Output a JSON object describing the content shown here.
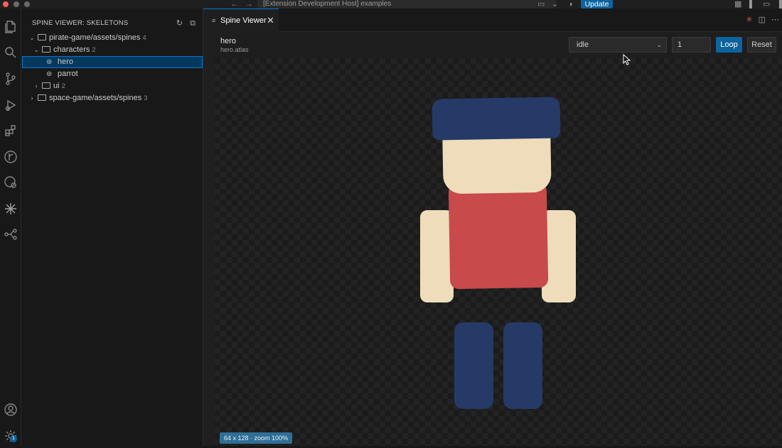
{
  "titlebar": {
    "window_title": "[Extension Development Host] examples",
    "update_label": "Update",
    "back_icon": "arrow-left-icon",
    "forward_icon": "arrow-right-icon"
  },
  "activity_bar": {
    "items": [
      "explorer-icon",
      "search-icon",
      "source-control-icon",
      "run-debug-icon",
      "extensions-icon",
      "git-graph-icon",
      "remote-explorer-icon",
      "spine-icon",
      "branches-icon"
    ],
    "account_icon": "account-icon",
    "settings_icon": "gear-icon",
    "settings_badge": "1"
  },
  "sidebar": {
    "title": "SPINE VIEWER: SKELETONS",
    "tree": [
      {
        "label": "pirate-game/assets/spines",
        "count": "4"
      },
      {
        "label": "characters",
        "count": "2"
      },
      {
        "label": "hero"
      },
      {
        "label": "parrot"
      },
      {
        "label": "ui",
        "count": "2"
      },
      {
        "label": "space-game/assets/spines",
        "count": "3"
      }
    ]
  },
  "editor": {
    "tab_label": "Spine Viewer",
    "skeleton_name": "hero",
    "atlas_name": "hero.atlas",
    "animation": "idle",
    "speed": "1",
    "loop_label": "Loop",
    "reset_label": "Reset",
    "zoom_info": "64 x 128 · zoom 100%"
  },
  "colors": {
    "accent": "#0e639c",
    "hat": "#253a66",
    "skin": "#eedcbb",
    "shirt": "#c84a4a"
  }
}
